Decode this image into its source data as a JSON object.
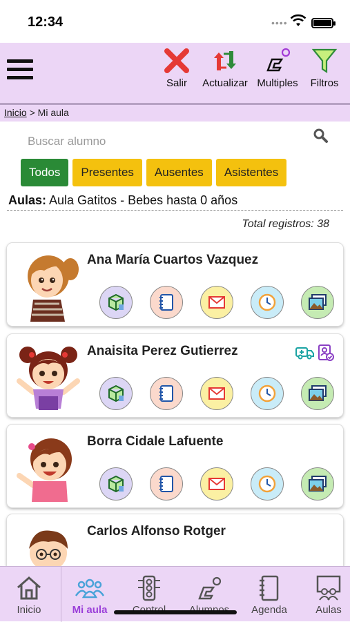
{
  "status": {
    "time": "12:34"
  },
  "toolbar": {
    "salir": "Salir",
    "actualizar": "Actualizar",
    "multiples": "Multiples",
    "filtros": "Filtros"
  },
  "breadcrumb": {
    "home": "Inicio",
    "separator": " > ",
    "current": "Mi aula"
  },
  "search": {
    "placeholder": "Buscar alumno"
  },
  "filters": [
    "Todos",
    "Presentes",
    "Ausentes",
    "Asistentes"
  ],
  "aulas": {
    "label": "Aulas:",
    "value": "Aula Gatitos - Bebes hasta 0 años"
  },
  "total": "Total registros: 38",
  "students": [
    {
      "name": "Ana María Cuartos Vazquez"
    },
    {
      "name": "Anaisita Perez Gutierrez"
    },
    {
      "name": "Borra Cidale Lafuente"
    },
    {
      "name": "Carlos Alfonso Rotger"
    }
  ],
  "tabs": [
    "Inicio",
    "Mi aula",
    "Control",
    "Alumnos",
    "Agenda",
    "Aulas"
  ],
  "colors": {
    "header_bg": "#ecd6f6",
    "active_filter": "#2a8a36",
    "filter": "#f4c10e",
    "active_tab": "#9b3fd9"
  }
}
